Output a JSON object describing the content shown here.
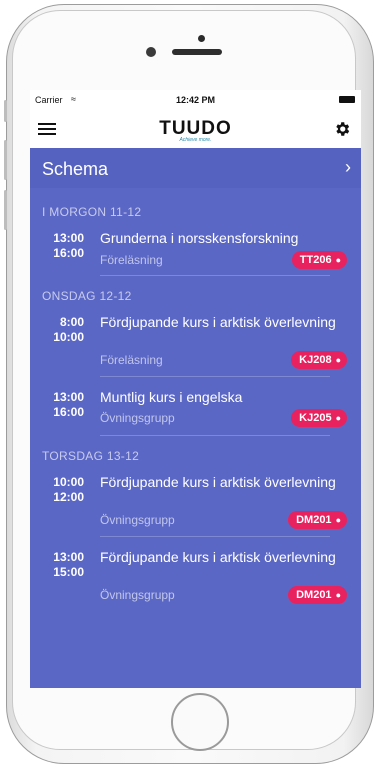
{
  "status_bar": {
    "carrier": "Carrier",
    "time": "12:42 PM"
  },
  "app": {
    "logo": "TUUDO",
    "tagline": "Achieve more."
  },
  "schedule": {
    "title": "Schema",
    "sections": [
      {
        "label": "I MORGON 11-12",
        "entries": [
          {
            "start": "13:00",
            "end": "16:00",
            "course": "Grunderna i norsskensforskning",
            "type": "Föreläsning",
            "room": "TT206"
          }
        ]
      },
      {
        "label": "ONSDAG 12-12",
        "entries": [
          {
            "start": "8:00",
            "end": "10:00",
            "course": "Fördjupande kurs i arktisk överlevning",
            "type": "Föreläsning",
            "room": "KJ208"
          },
          {
            "start": "13:00",
            "end": "16:00",
            "course": "Muntlig kurs i engelska",
            "type": "Övningsgrupp",
            "room": "KJ205"
          }
        ]
      },
      {
        "label": "TORSDAG 13-12",
        "entries": [
          {
            "start": "10:00",
            "end": "12:00",
            "course": "Fördjupande kurs i arktisk överlevning",
            "type": "Övningsgrupp",
            "room": "DM201"
          },
          {
            "start": "13:00",
            "end": "15:00",
            "course": "Fördjupande kurs i arktisk överlevning",
            "type": "Övningsgrupp",
            "room": "DM201"
          }
        ]
      }
    ]
  },
  "colors": {
    "background": "#5b67c4",
    "badge": "#e8225f"
  },
  "icons": {
    "menu": "hamburger-icon",
    "settings": "gear-icon",
    "forward": "chevron-right-icon",
    "location": "pin-icon"
  }
}
